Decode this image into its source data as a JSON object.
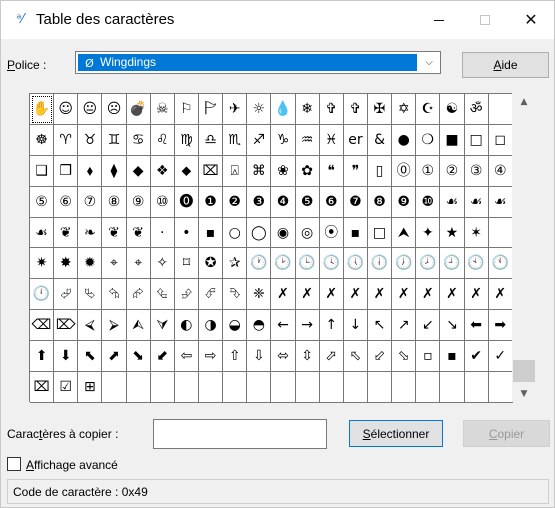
{
  "window": {
    "title": "Table des caractères",
    "app_icon": "character-map-icon"
  },
  "font": {
    "label_prefix": "P",
    "label_rest": "olice :",
    "selected": "Wingdings",
    "type_icon": "opentype-font-icon"
  },
  "buttons": {
    "help_prefix": "A",
    "help_rest": "ide",
    "select_prefix": "S",
    "select_rest": "électionner",
    "copy_prefix": "C",
    "copy_rest": "opier"
  },
  "copy": {
    "label_pre": "Carac",
    "label_under": "t",
    "label_post": "ères à copier :",
    "value": ""
  },
  "advanced": {
    "label_under": "A",
    "label_rest": "ffichage avancé",
    "checked": false
  },
  "status": {
    "text": "Code de caractère : 0x49"
  },
  "grid": {
    "selected_index": 0,
    "rows": [
      [
        "✋",
        "☺",
        "😐",
        "☹",
        "💣",
        "☠",
        "⚐",
        "🏱",
        "✈",
        "☼",
        "💧",
        "❄",
        "✞",
        "✞",
        "✠",
        "✡",
        "☪",
        "☯",
        "ॐ"
      ],
      [
        "☸",
        "♈",
        "♉",
        "♊",
        "♋",
        "♌",
        "♍",
        "♎",
        "♏",
        "♐",
        "♑",
        "♒",
        "♓",
        "er",
        "&",
        "●",
        "❍",
        "■",
        "□",
        "◻"
      ],
      [
        "❑",
        "❒",
        "⬧",
        "⧫",
        "◆",
        "❖",
        "⬥",
        "⌧",
        "⍓",
        "⌘",
        "❀",
        "✿",
        "❝",
        "❞",
        "▯",
        "⓪",
        "①",
        "②",
        "③",
        "④"
      ],
      [
        "⑤",
        "⑥",
        "⑦",
        "⑧",
        "⑨",
        "⑩",
        "⓿",
        "❶",
        "❷",
        "❸",
        "❹",
        "❺",
        "❻",
        "❼",
        "❽",
        "❾",
        "❿",
        "☙",
        "☙",
        "☙"
      ],
      [
        "☙",
        "❦",
        "❧",
        "❦",
        "❦",
        "·",
        "•",
        "▪",
        "○",
        "◯",
        "◉",
        "◎",
        "⦿",
        "▪",
        "□",
        "⮝",
        "✦",
        "★",
        "✶"
      ],
      [
        "✷",
        "✸",
        "✹",
        "⌖",
        "⌖",
        "✧",
        "⌑",
        "✪",
        "✰",
        "🕐",
        "🕑",
        "🕒",
        "🕓",
        "🕔",
        "🕕",
        "🕖",
        "🕗",
        "🕘",
        "🕙",
        "🕚"
      ],
      [
        "🕛",
        "⮰",
        "⮱",
        "⮲",
        "⮳",
        "⮴",
        "⮵",
        "⮶",
        "⮷",
        "❈",
        "✗",
        "✗",
        "✗",
        "✗",
        "✗",
        "✗",
        "✗",
        "✗",
        "✗",
        "✗"
      ],
      [
        "⌫",
        "⌦",
        "⮘",
        "⮚",
        "⮙",
        "⮛",
        "◐",
        "◑",
        "◒",
        "◓",
        "←",
        "→",
        "↑",
        "↓",
        "↖",
        "↗",
        "↙",
        "↘",
        "⬅",
        "➡"
      ],
      [
        "⬆",
        "⬇",
        "⬉",
        "⬈",
        "⬊",
        "⬋",
        "⇦",
        "⇨",
        "⇧",
        "⇩",
        "⬄",
        "⇳",
        "⬀",
        "⬁",
        "⬃",
        "⬂",
        "▫",
        "▪",
        "✔",
        "✓"
      ],
      [
        "⌧",
        "☑",
        "⊞",
        "",
        "",
        "",
        "",
        "",
        "",
        "",
        "",
        "",
        "",
        "",
        "",
        "",
        "",
        "",
        "",
        ""
      ]
    ]
  }
}
